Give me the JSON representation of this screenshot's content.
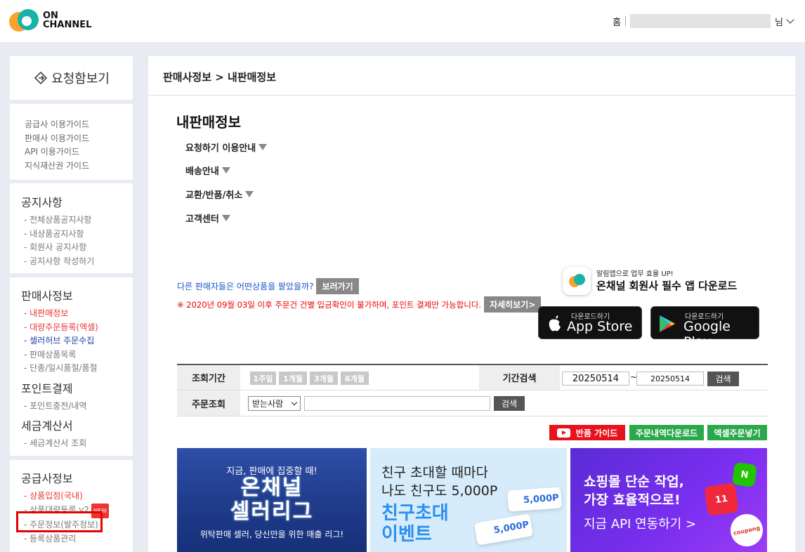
{
  "header": {
    "logo_line1": "ON",
    "logo_line2": "CHANNEL",
    "home_label": "홈",
    "user_suffix": "님"
  },
  "sidebar": {
    "request_label": "요청함보기",
    "guides": [
      "공급사 이용가이드",
      "판매사 이용가이드",
      "API 이용가이드",
      "지식재산권 가이드"
    ],
    "notice": {
      "title": "공지사항",
      "items": [
        "- 전체상품공지사항",
        "- 내상품공지사항",
        "- 회원사 공지사항",
        "- 공지사항 작성하기"
      ]
    },
    "seller": {
      "title": "판매사정보",
      "items": [
        "- 내판매정보",
        "- 대량주문등록(엑셀)",
        "- 셀러허브 주문수집",
        "- 판매상품목록",
        "- 단종/일시품절/품절"
      ]
    },
    "point": {
      "title": "포인트결제",
      "items": [
        "- 포인트충전/내역"
      ]
    },
    "tax": {
      "title": "세금계산서",
      "items": [
        "- 세금계산서 조회"
      ]
    },
    "supplier": {
      "title": "공급사정보",
      "items": [
        "- 상품입점(국내)",
        "- 상품대량등록 v2",
        "- 주문정보(발주정보)",
        "- 등록상품관리"
      ],
      "new_badge": "NEW"
    }
  },
  "main": {
    "breadcrumb": "판매사정보 > 내판매정보",
    "title": "내판매정보",
    "accordions": [
      "요청하기 이용안내",
      "배송안내",
      "교환/반품/취소",
      "고객센터"
    ],
    "other_sellers_text": "다른 판매자들은 어떤상품을 팔았을까?",
    "view_btn": "보러가기",
    "warning_text": "※ 2020년 09월 03일 이후 주문건 건별 입금확인이 불가하며, 포인트 결제만 가능합니다.",
    "detail_btn": "자세히보기>",
    "app_promo_sub": "알림앱으로 업무 효율 UP!",
    "app_promo_main": "온채널 회원사 필수 앱 다운로드",
    "appstore_small": "다운로드하기",
    "appstore_big": "App Store",
    "googleplay_small": "다운로드하기",
    "googleplay_big": "Google Play"
  },
  "search": {
    "period_label": "조회기간",
    "period_buttons": [
      "1주일",
      "1개월",
      "3개월",
      "6개월"
    ],
    "range_label": "기간검색",
    "date_from": "20250514",
    "tilde": "~",
    "date_to": "20250514",
    "search_btn": "검색",
    "order_label": "주문조회",
    "select_value": "받는사람",
    "order_search_btn": "검색"
  },
  "actions": {
    "return_guide": "반품 가이드",
    "order_download": "주문내역다운로드",
    "excel_order": "엑셀주문넣기",
    "return_color": "#e8121c",
    "green_color": "#2aa84a"
  },
  "banners": {
    "b1_line1": "지금, 판매에 집중할 때!",
    "b1_line2a": "온채널",
    "b1_line2b": "셀러리그",
    "b1_line3": "위탁판매 셀러, 당신만을 위한 매출 리그!",
    "b2_line1": "친구 초대할 때마다",
    "b2_line2": "나도 친구도 5,000P",
    "b2_line3": "친구초대",
    "b2_line4": "이벤트",
    "b2_card1": "5,000P",
    "b2_card2": "5,000P",
    "b3_line1": "쇼핑몰 단순 작업,",
    "b3_line2": "가장 효율적으로!",
    "b3_line3": "지금 API 연동하기 >",
    "b3_tile1": "11",
    "b3_tile2": "coupang"
  }
}
